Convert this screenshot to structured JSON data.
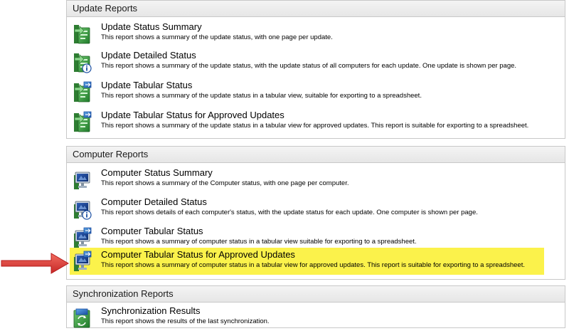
{
  "update_reports": {
    "header": "Update Reports",
    "items": [
      {
        "title": "Update Status Summary",
        "desc": "This report shows a summary of the update status, with one page per update."
      },
      {
        "title": "Update Detailed Status",
        "desc": "This report shows a summary of the update status, with the update status of all computers for each update. One update is shown per page."
      },
      {
        "title": "Update Tabular Status",
        "desc": "This report shows a summary of the update status in a tabular view, suitable for exporting to a spreadsheet."
      },
      {
        "title": "Update Tabular Status for Approved Updates",
        "desc": "This report shows a summary of the update status in a tabular view for approved updates. This report is suitable for exporting to a spreadsheet."
      }
    ]
  },
  "computer_reports": {
    "header": "Computer Reports",
    "items": [
      {
        "title": "Computer Status Summary",
        "desc": "This report shows a summary of the Computer status, with one page per computer."
      },
      {
        "title": "Computer Detailed Status",
        "desc": "This report shows details of each computer's status, with the update status for each update. One computer is shown per page."
      },
      {
        "title": "Computer Tabular Status",
        "desc": "This report shows a summary of computer status in a tabular view suitable for exporting to a spreadsheet."
      },
      {
        "title": "Computer Tabular Status for Approved Updates",
        "desc": "This report shows a summary of computer status in a tabular view for approved updates. This report is suitable for exporting to a spreadsheet."
      }
    ]
  },
  "synchronization_reports": {
    "header": "Synchronization Reports",
    "items": [
      {
        "title": "Synchronization Results",
        "desc": "This report shows the results of the last synchronization."
      }
    ]
  },
  "colors": {
    "highlight": "#fbf24b",
    "arrow": "#e53935",
    "header_bg": "#ececec"
  }
}
